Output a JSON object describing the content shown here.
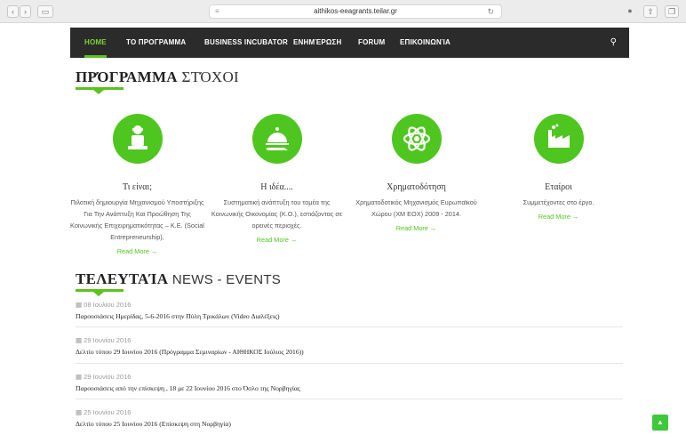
{
  "browser": {
    "url": "aithikos-eeagrants.teilar.gr"
  },
  "nav": {
    "items": [
      {
        "label": "HOME",
        "active": true
      },
      {
        "label": "ΤΟ ΠΡΟΓΡΑΜΜΑ"
      },
      {
        "label": "BUSINESS INCUBATOR"
      },
      {
        "label": "ΕΝΗΜΈΡΩΣΗ"
      },
      {
        "label": "FORUM"
      },
      {
        "label": "ΕΠΙΚΟΙΝΩΝΊΑ"
      }
    ]
  },
  "program": {
    "title_bold": "ΠΡΌΓΡΑΜΜΑ",
    "title_light": "ΣΤΌΧΟΙ",
    "read_more": "Read More →",
    "features": [
      {
        "icon": "worker-icon",
        "title": "Τι είναι;",
        "desc": "Πιλοτική δημιουργία Μηχανισμού Υποστήριξης Για Την Ανάπτυξη Και Προώθηση Της Κοινωνικής Επιχειρηματικότητας – Κ.Ε. (Social Entrepreneurship),"
      },
      {
        "icon": "serving-tray-icon",
        "title": "Η ιδέα....",
        "desc": "Συστηματική ανάπτυξη του τομέα της Κοινωνικής Οικονομίας (Κ.Ο.), εστιάζοντας σε ορεινές περιοχές."
      },
      {
        "icon": "atom-icon",
        "title": "Χρηματοδότηση",
        "desc": "Χρηματοδοτικός Μηχανισμός Ευρωπαϊκού Χώρου (ΧΜ ΕΟΧ) 2009 - 2014."
      },
      {
        "icon": "factory-icon",
        "title": "Εταίροι",
        "desc": "Συμμετέχοντες στο έργο."
      }
    ]
  },
  "news": {
    "title_bold": "ΤΕΛΕΥΤΑΊΑ",
    "title_light": "NEWS - EVENTS",
    "items": [
      {
        "date": "08 Ιουλίου 2016",
        "title": "Παρουσιάσεις Ημερίδας, 5-6-2016 στην Πύλη Τρικάλων (Video Διαλέξεις)"
      },
      {
        "date": "29 Ιουνίου 2016",
        "title": "Δελτίο τύπου 29 Ιουνίου 2016 (Πρόγραμμα Σεμιναρίων - ΑΙΘΗΚΟΣ Ιούλιος 2016))"
      },
      {
        "date": "29 Ιουνίου 2016",
        "title": "Παρουσιάσεις από την επίσκεψη , 18 με 22 Ιουνίου 2016 στο Όσλο της Νορβηγίας"
      },
      {
        "date": "25 Ιουνίου 2016",
        "title": "Δελτίο τύπου 25 Ιουνίου 2016 (Επίσκεψη στη Νορβηγία)"
      }
    ]
  },
  "colors": {
    "accent": "#4fc61f",
    "nav_bg": "#2b2b2b"
  }
}
